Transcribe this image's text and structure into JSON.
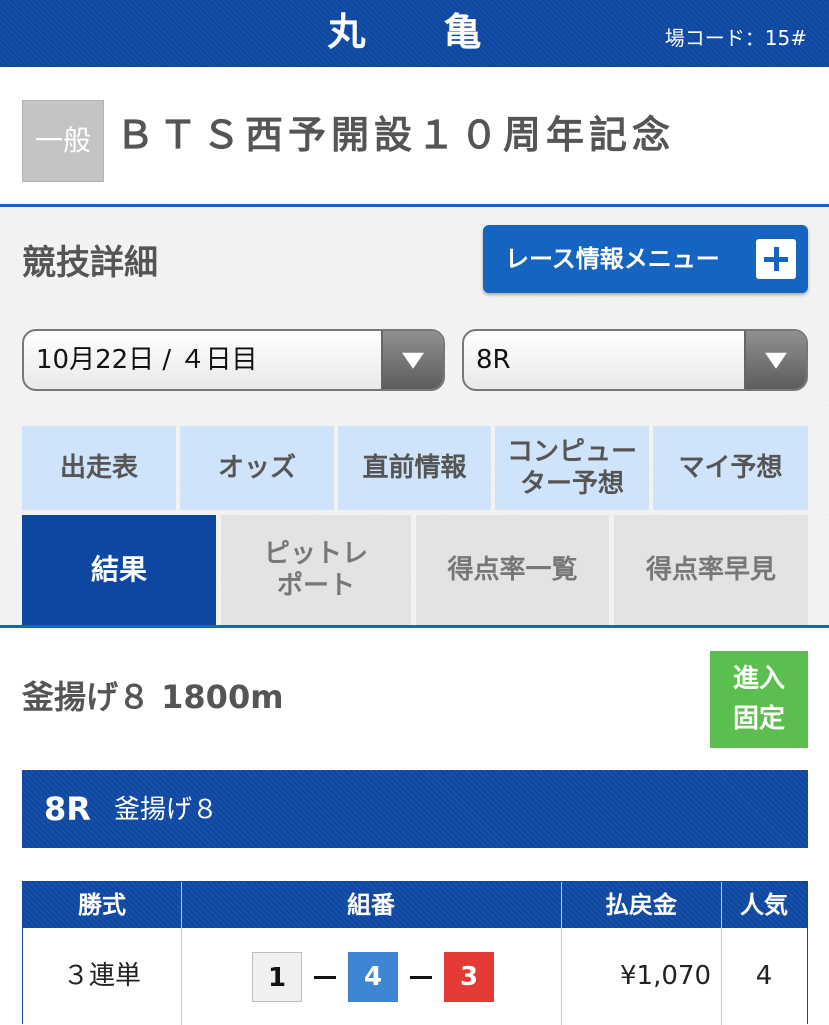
{
  "header": {
    "venue": "丸　亀",
    "venue_code": "場コード：15#"
  },
  "race_title": {
    "grade": "一般",
    "title": "ＢＴＳ西予開設１０周年記念"
  },
  "section": {
    "title": "競技詳細",
    "menu_button": "レース情報メニュー"
  },
  "selectors": {
    "date": "10月22日 / ４日目",
    "race": "8R"
  },
  "tabs_row1": [
    {
      "label": "出走表"
    },
    {
      "label": "オッズ"
    },
    {
      "label": "直前情報"
    },
    {
      "label": "コンピュー",
      "label2": "ター予想"
    },
    {
      "label": "マイ予想"
    }
  ],
  "tabs_row2": [
    {
      "label": "結果"
    },
    {
      "label": "ピットレ",
      "label2": "ポート"
    },
    {
      "label": "得点率一覧"
    },
    {
      "label": "得点率早見"
    }
  ],
  "race": {
    "heading": "釜揚げ８ 1800m",
    "badge_line1": "進入",
    "badge_line2": "固定",
    "number": "8R",
    "name": "釜揚げ８"
  },
  "payout": {
    "headers": {
      "type": "勝式",
      "combo": "組番",
      "amount": "払戻金",
      "popularity": "人気"
    },
    "rows": [
      {
        "type": "３連単",
        "combo": [
          "1",
          "4",
          "3"
        ],
        "amount": "¥1,070",
        "popularity": "4"
      }
    ]
  },
  "colors": {
    "primary": "#0d47a1",
    "accent": "#1565c0",
    "tab_light": "#cfe4fb",
    "tab_gray": "#e3e3e3",
    "badge_green": "#5bbf4f",
    "boat1": "#f0f0f0",
    "boat4": "#3e86d5",
    "boat3": "#e53935"
  }
}
